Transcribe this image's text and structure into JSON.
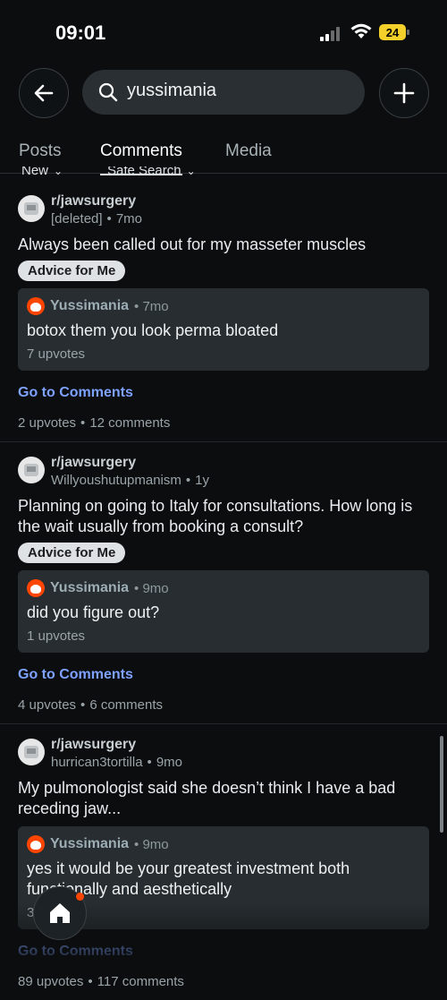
{
  "status": {
    "time": "09:01",
    "battery": "24"
  },
  "search": {
    "query": "yussimania"
  },
  "tabs": [
    {
      "label": "Posts"
    },
    {
      "label": "Comments"
    },
    {
      "label": "Media"
    }
  ],
  "filters": {
    "sort": "New",
    "safe": "Safe Search"
  },
  "results": [
    {
      "subreddit": "r/jawsurgery",
      "author": "[deleted]",
      "time": "7mo",
      "title": "Always been called out for my  masseter muscles",
      "flair": "Advice for Me",
      "comment": {
        "user": "Yussimania",
        "time": "7mo",
        "body": "botox them you look perma bloated",
        "votes": "7 upvotes"
      },
      "goto": "Go to Comments",
      "upvotes": "2 upvotes",
      "comments": "12 comments"
    },
    {
      "subreddit": "r/jawsurgery",
      "author": "Willyoushutupmanism",
      "time": "1y",
      "title": "Planning on going to Italy for consultations. How long is the wait usually from booking a consult?",
      "flair": "Advice for Me",
      "comment": {
        "user": "Yussimania",
        "time": "9mo",
        "body": "did you figure out?",
        "votes": "1 upvotes"
      },
      "goto": "Go to Comments",
      "upvotes": "4 upvotes",
      "comments": "6 comments"
    },
    {
      "subreddit": "r/jawsurgery",
      "author": "hurrican3tortilla",
      "time": "9mo",
      "title": "My pulmonologist said she doesn’t think I have a bad receding jaw...",
      "flair": "",
      "comment": {
        "user": "Yussimania",
        "time": "9mo",
        "body": "yes it would be your greatest investment both functionally and aesthetically",
        "votes": "3 upvotes"
      },
      "goto": "Go to Comments",
      "upvotes": "89 upvotes",
      "comments": "117 comments"
    }
  ]
}
